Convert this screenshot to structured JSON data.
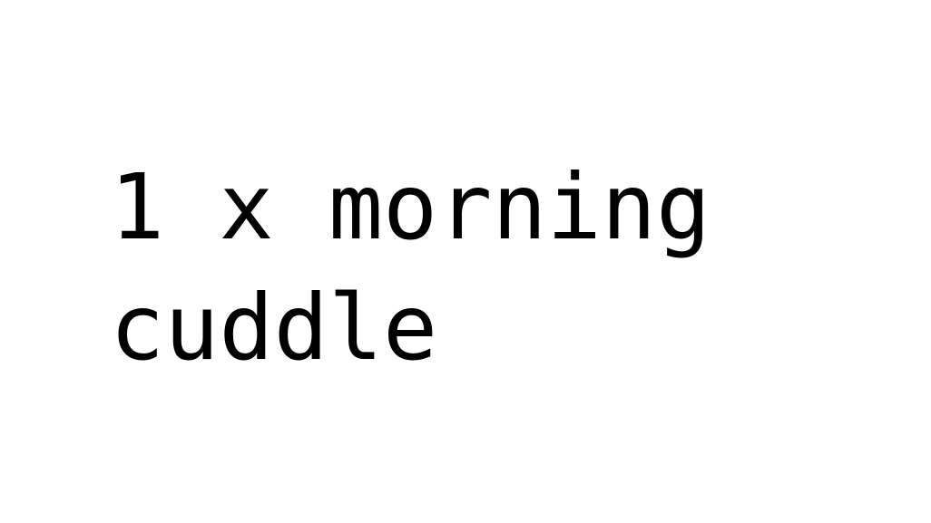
{
  "card": {
    "lines": [
      "1 x morning",
      "cuddle"
    ]
  },
  "colors": {
    "background": "#ffffff",
    "text": "#000000"
  }
}
